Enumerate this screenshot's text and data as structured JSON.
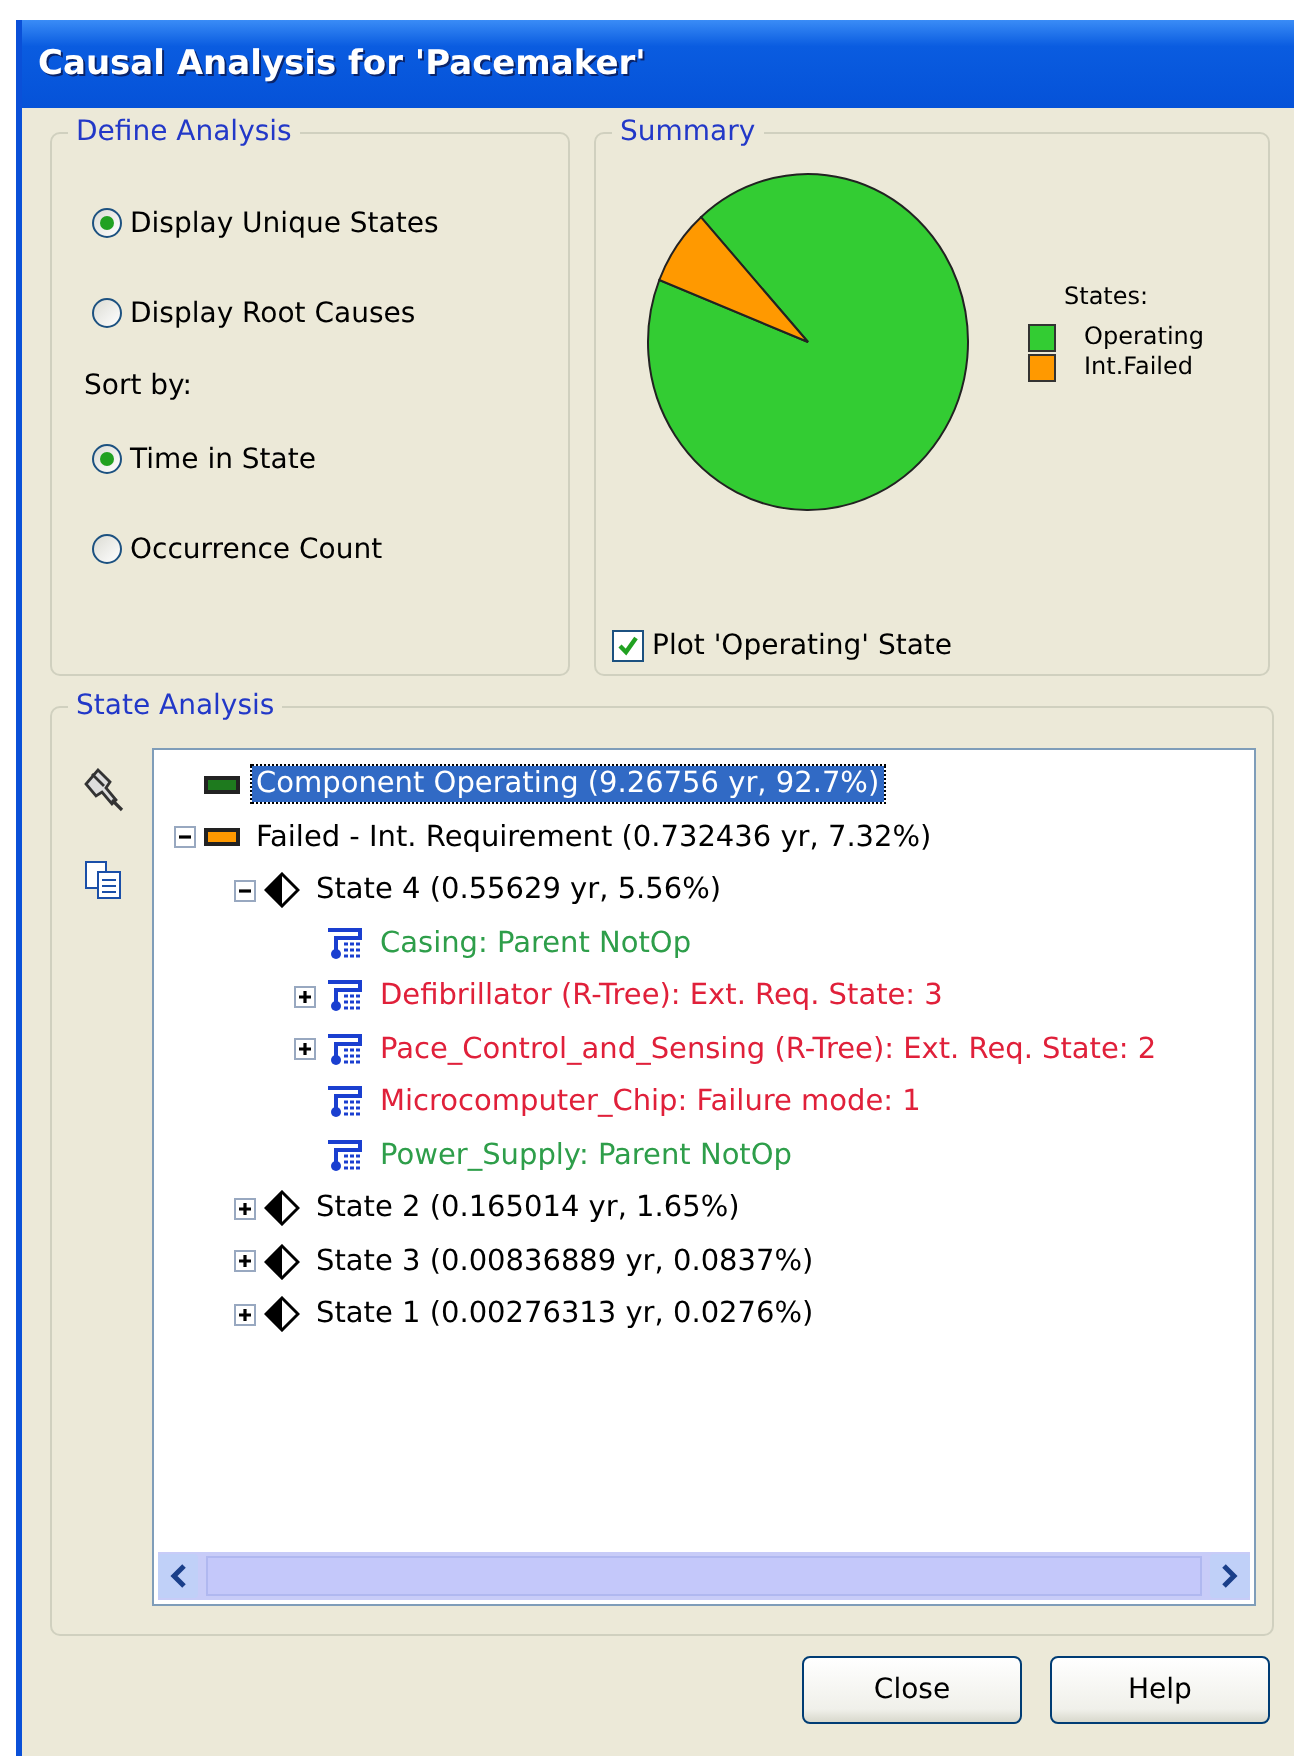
{
  "window": {
    "title": "Causal Analysis for 'Pacemaker'"
  },
  "define_analysis": {
    "title": "Define Analysis",
    "display_options": [
      {
        "label": "Display Unique States",
        "selected": true
      },
      {
        "label": "Display Root Causes",
        "selected": false
      }
    ],
    "sort_label": "Sort by:",
    "sort_options": [
      {
        "label": "Time in State",
        "selected": true
      },
      {
        "label": "Occurrence Count",
        "selected": false
      }
    ]
  },
  "summary": {
    "title": "Summary",
    "chart_data": {
      "type": "pie",
      "categories": [
        "Operating",
        "Int.Failed"
      ],
      "values": [
        92.7,
        7.32
      ]
    },
    "legend_title": "States:",
    "legend": [
      {
        "color": "#33cc33"
      },
      {
        "color": "#ff9900"
      }
    ],
    "plot_operating": {
      "label": "Plot 'Operating' State",
      "checked": true
    }
  },
  "state_analysis": {
    "title": "State Analysis",
    "tree": [
      {
        "kind": "status",
        "color": "#1e7a1e",
        "label": "Component Operating (9.26756 yr, 92.7%)",
        "selected": true
      },
      {
        "kind": "status",
        "color": "#ff9900",
        "label": "Failed - Int. Requirement (0.732436 yr, 7.32%)",
        "selected": false,
        "expanded": true,
        "children": [
          {
            "kind": "state",
            "label": "State 4 (0.55629 yr, 5.56%)",
            "selected": false,
            "expanded": true,
            "children": [
              {
                "kind": "cause",
                "label": "Casing: Parent NotOp",
                "selected": false,
                "color": "#2e9e4a"
              },
              {
                "kind": "cause",
                "label": "Defibrillator (R-Tree): Ext. Req. State: 3",
                "selected": false,
                "expanded": false,
                "color": "#e0203a"
              },
              {
                "kind": "cause",
                "label": "Pace_Control_and_Sensing (R-Tree): Ext. Req. State: 2",
                "selected": false,
                "expanded": false,
                "color": "#e0203a"
              },
              {
                "kind": "cause",
                "label": "Microcomputer_Chip: Failure mode: 1",
                "selected": false,
                "color": "#e0203a"
              },
              {
                "kind": "cause",
                "label": "Power_Supply: Parent NotOp",
                "selected": false,
                "color": "#2e9e4a"
              }
            ]
          },
          {
            "kind": "state",
            "label": "State 2 (0.165014 yr, 1.65%)",
            "selected": false,
            "expanded": false
          },
          {
            "kind": "state",
            "label": "State 3 (0.00836889 yr, 0.0837%)",
            "selected": false,
            "expanded": false
          },
          {
            "kind": "state",
            "label": "State 1 (0.00276313 yr, 0.0276%)",
            "selected": false,
            "expanded": false
          }
        ]
      }
    ]
  },
  "buttons": [
    {
      "label": "Close"
    },
    {
      "label": "Help"
    }
  ]
}
